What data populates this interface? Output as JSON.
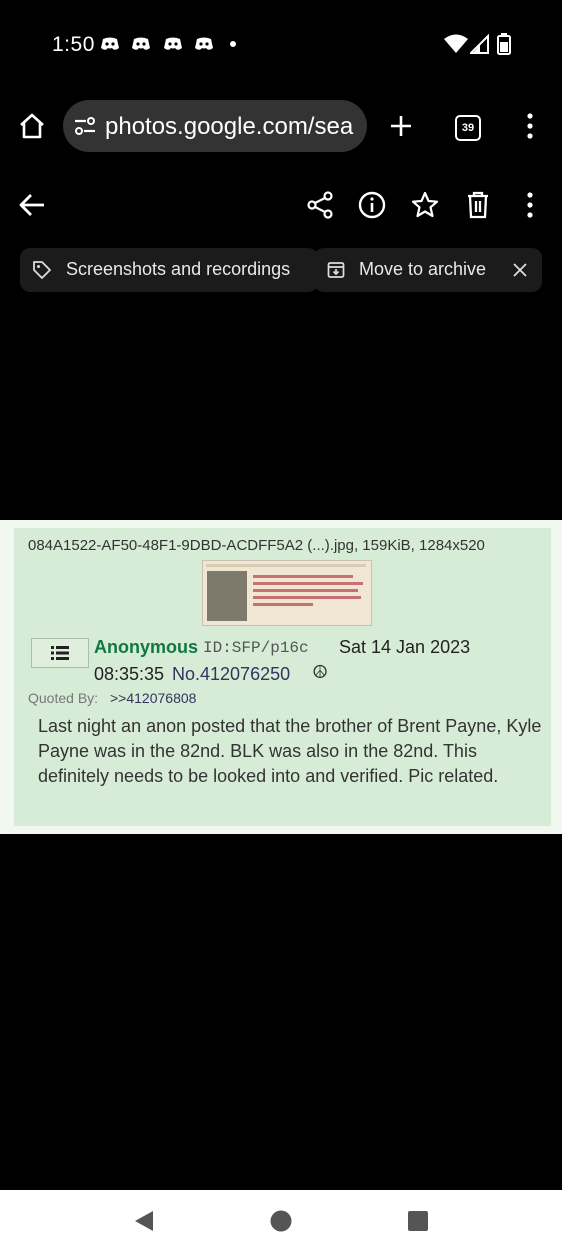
{
  "status_bar": {
    "time": "1:50",
    "notification_icons": [
      "discord-icon",
      "discord-icon",
      "discord-icon",
      "discord-icon",
      "dot-icon"
    ],
    "right_icons": [
      "wifi-icon",
      "signal-icon",
      "battery-icon"
    ]
  },
  "browser": {
    "url": "photos.google.com/sea",
    "tab_count": "39"
  },
  "photo_toolbar": {
    "icons": [
      "back-arrow-icon",
      "share-icon",
      "info-icon",
      "star-icon",
      "delete-icon",
      "more-icon"
    ]
  },
  "chips": {
    "album_label": "Screenshots and recordings",
    "archive_label": "Move to archive"
  },
  "post": {
    "file_info": "084A1522-AF50-48F1-9DBD-ACDFF5A2 (...).jpg, 159KiB, 1284x520",
    "name": "Anonymous",
    "poster_id": "ID:SFP/p16c",
    "date": "Sat 14 Jan 2023",
    "time": "08:35:35",
    "number": "No.412076250",
    "flag": "☮",
    "quoted_by_label": "Quoted By:",
    "quoted_by_link": ">>412076808",
    "comment": "Last night an anon posted that the brother of Brent Payne, Kyle Payne was in the 82nd. BLK was also in the 82nd. This definitely needs to be looked into and verified. Pic related."
  },
  "nav_bar": {
    "buttons": [
      "back-triangle-icon",
      "home-circle-icon",
      "recents-square-icon"
    ]
  }
}
